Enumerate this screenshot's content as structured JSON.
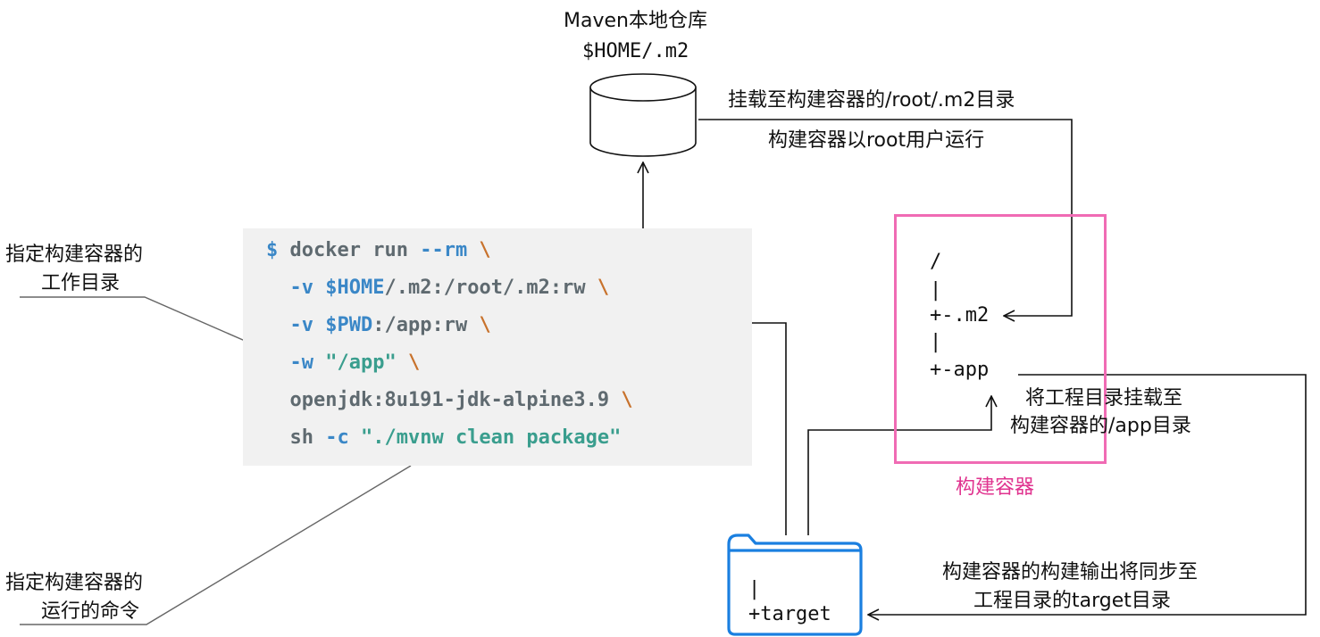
{
  "repo": {
    "title": "Maven本地仓库",
    "path": "$HOME/.m2"
  },
  "mount_m2": {
    "line1": "挂载至构建容器的/root/.m2目录",
    "line2": "构建容器以root用户运行"
  },
  "labels": {
    "workdir_line1": "指定构建容器的",
    "workdir_line2": "工作目录",
    "cmd_line1": "指定构建容器的",
    "cmd_line2": "运行的命令",
    "mount_app_line1": "将工程目录挂载至",
    "mount_app_line2": "构建容器的/app目录",
    "container": "构建容器",
    "sync_line1": "构建容器的构建输出将同步至",
    "sync_line2": "工程目录的target目录"
  },
  "code": {
    "line1": [
      {
        "t": "$ ",
        "c": "prompt"
      },
      {
        "t": "docker run ",
        "c": "txt"
      },
      {
        "t": "--rm",
        "c": "flag"
      },
      {
        "t": " \\",
        "c": "bs"
      }
    ],
    "line2": [
      {
        "t": "  ",
        "c": "txt"
      },
      {
        "t": "-v",
        "c": "flag"
      },
      {
        "t": " ",
        "c": "txt"
      },
      {
        "t": "$HOME",
        "c": "var"
      },
      {
        "t": "/.m2:/root/.m2:rw",
        "c": "txt"
      },
      {
        "t": " \\",
        "c": "bs"
      }
    ],
    "line3": [
      {
        "t": "  ",
        "c": "txt"
      },
      {
        "t": "-v",
        "c": "flag"
      },
      {
        "t": " ",
        "c": "txt"
      },
      {
        "t": "$PWD",
        "c": "var"
      },
      {
        "t": ":/app:rw",
        "c": "txt"
      },
      {
        "t": " \\",
        "c": "bs"
      }
    ],
    "line4": [
      {
        "t": "  ",
        "c": "txt"
      },
      {
        "t": "-w",
        "c": "flag"
      },
      {
        "t": " ",
        "c": "txt"
      },
      {
        "t": "\"/app\"",
        "c": "str"
      },
      {
        "t": " \\",
        "c": "bs"
      }
    ],
    "line5": [
      {
        "t": "  openjdk:8u191-jdk-alpine3.9",
        "c": "txt"
      },
      {
        "t": " \\",
        "c": "bs"
      }
    ],
    "line6": [
      {
        "t": "  sh ",
        "c": "txt"
      },
      {
        "t": "-c",
        "c": "flag"
      },
      {
        "t": " ",
        "c": "txt"
      },
      {
        "t": "\"./mvnw clean package\"",
        "c": "str"
      }
    ]
  },
  "container_tree": {
    "root": "/",
    "pipe1": "|",
    "m2": "+-.m2",
    "pipe2": "|",
    "app": "+-app"
  },
  "folder_tree": {
    "pipe": "|",
    "target": "+target"
  },
  "colors": {
    "container_border": "#f06bb4",
    "container_label": "#e0338f",
    "folder_stroke": "#1a7fe0"
  }
}
